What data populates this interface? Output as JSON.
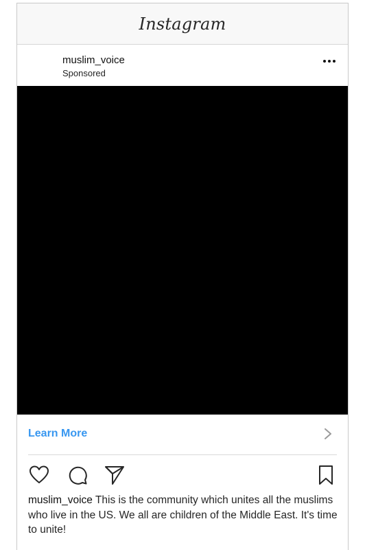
{
  "app": {
    "logo_text": "Instagram"
  },
  "post": {
    "username": "muslim_voice",
    "label": "Sponsored",
    "more_icon": "more-horizontal-icon",
    "media_color": "#000000"
  },
  "cta": {
    "label": "Learn More",
    "color": "#3897f0",
    "icon": "chevron-right-icon"
  },
  "actions": {
    "icons": [
      "heart-icon",
      "comment-icon",
      "share-icon",
      "bookmark-icon"
    ]
  },
  "caption": {
    "username": "muslim_voice",
    "text": "This is the community which unites all the muslims who live in the US. We all are children of the Middle East. It's time to unite!"
  }
}
